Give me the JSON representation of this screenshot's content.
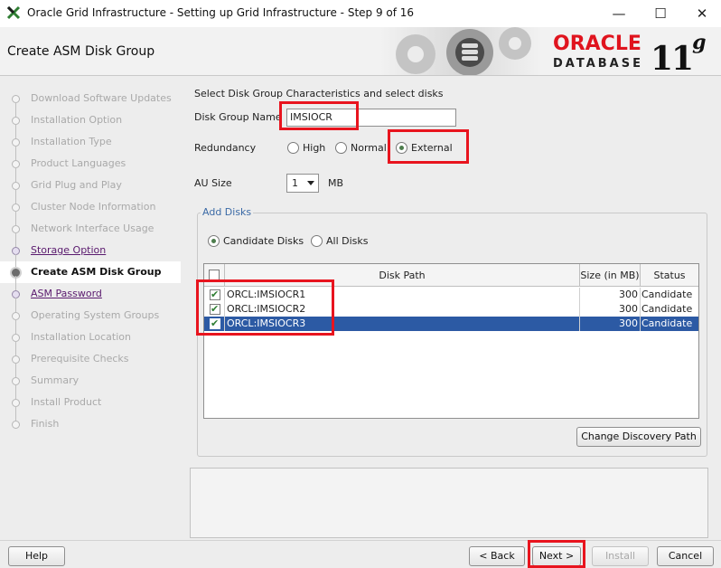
{
  "window": {
    "title": "Oracle Grid Infrastructure - Setting up Grid Infrastructure - Step 9 of 16",
    "minimize": "—",
    "maximize": "☐",
    "close": "✕"
  },
  "header": {
    "page_title": "Create ASM Disk Group",
    "logo_oracle": "ORACLE",
    "logo_database": "DATABASE",
    "logo_version": "11",
    "logo_version_suffix": "g"
  },
  "nav": {
    "items": [
      {
        "label": "Download Software Updates",
        "state": "pending"
      },
      {
        "label": "Installation Option",
        "state": "pending"
      },
      {
        "label": "Installation Type",
        "state": "pending"
      },
      {
        "label": "Product Languages",
        "state": "pending"
      },
      {
        "label": "Grid Plug and Play",
        "state": "pending"
      },
      {
        "label": "Cluster Node Information",
        "state": "pending"
      },
      {
        "label": "Network Interface Usage",
        "state": "pending"
      },
      {
        "label": "Storage Option",
        "state": "done"
      },
      {
        "label": "Create ASM Disk Group",
        "state": "current"
      },
      {
        "label": "ASM Password",
        "state": "done"
      },
      {
        "label": "Operating System Groups",
        "state": "pending"
      },
      {
        "label": "Installation Location",
        "state": "pending"
      },
      {
        "label": "Prerequisite Checks",
        "state": "pending"
      },
      {
        "label": "Summary",
        "state": "pending"
      },
      {
        "label": "Install Product",
        "state": "pending"
      },
      {
        "label": "Finish",
        "state": "pending"
      }
    ]
  },
  "form": {
    "intro": "Select Disk Group Characteristics and select disks",
    "disk_group_label": "Disk Group Name",
    "disk_group_value": "IMSIOCR",
    "redundancy_label": "Redundancy",
    "redundancy_options": [
      "High",
      "Normal",
      "External"
    ],
    "redundancy_selected": "External",
    "au_size_label": "AU Size",
    "au_size_value": "1",
    "au_size_unit": "MB"
  },
  "add_disks": {
    "title": "Add Disks",
    "filter_options": [
      "Candidate Disks",
      "All Disks"
    ],
    "filter_selected": "Candidate Disks",
    "columns": [
      "Disk Path",
      "Size (in MB)",
      "Status"
    ],
    "rows": [
      {
        "checked": true,
        "path": "ORCL:IMSIOCR1",
        "size": "300",
        "status": "Candidate"
      },
      {
        "checked": true,
        "path": "ORCL:IMSIOCR2",
        "size": "300",
        "status": "Candidate"
      },
      {
        "checked": true,
        "path": "ORCL:IMSIOCR3",
        "size": "300",
        "status": "Candidate"
      }
    ],
    "change_discovery_label": "Change Discovery Path"
  },
  "buttons": {
    "help": "Help",
    "back": "< Back",
    "next": "Next >",
    "install": "Install",
    "cancel": "Cancel"
  },
  "colors": {
    "highlight": "#e8141e",
    "selection": "#2c5aa4",
    "oracle_red": "#e0141e"
  }
}
